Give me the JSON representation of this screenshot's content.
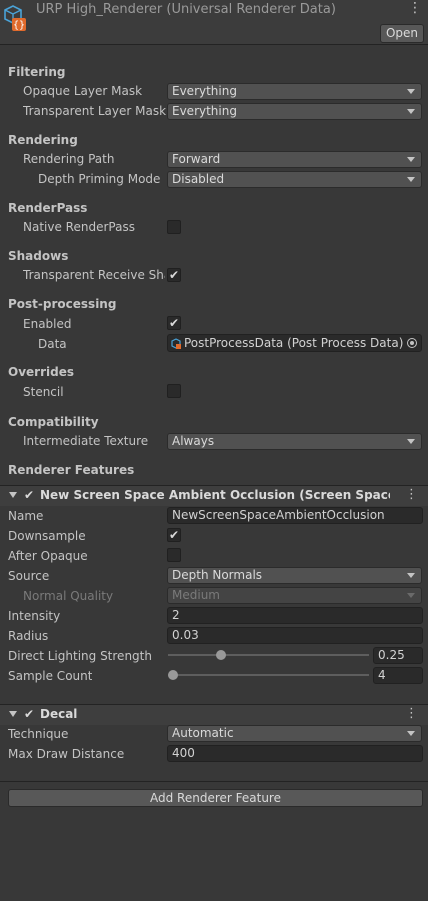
{
  "header": {
    "title": "URP High_Renderer (Universal Renderer Data)",
    "open_label": "Open",
    "menu_icon": "kebab-menu-icon",
    "asset_icon": "renderer-data-asset-icon"
  },
  "filtering": {
    "section": "Filtering",
    "opaque_label": "Opaque Layer Mask",
    "opaque_value": "Everything",
    "transparent_label": "Transparent Layer Mask",
    "transparent_value": "Everything"
  },
  "rendering": {
    "section": "Rendering",
    "path_label": "Rendering Path",
    "path_value": "Forward",
    "depth_label": "Depth Priming Mode",
    "depth_value": "Disabled"
  },
  "renderpass": {
    "section": "RenderPass",
    "native_label": "Native RenderPass",
    "native_checked": false
  },
  "shadows": {
    "section": "Shadows",
    "transparent_label": "Transparent Receive Sha",
    "transparent_checked": true
  },
  "postprocessing": {
    "section": "Post-processing",
    "enabled_label": "Enabled",
    "enabled_checked": true,
    "data_label": "Data",
    "data_value": "PostProcessData (Post Process Data)"
  },
  "overrides": {
    "section": "Overrides",
    "stencil_label": "Stencil",
    "stencil_checked": false
  },
  "compatibility": {
    "section": "Compatibility",
    "intermediate_label": "Intermediate Texture",
    "intermediate_value": "Always"
  },
  "renderer_features": {
    "section": "Renderer Features",
    "ssao": {
      "title": "New Screen Space Ambient Occlusion (Screen Space Amb",
      "enabled": true,
      "name_label": "Name",
      "name_value": "NewScreenSpaceAmbientOcclusion",
      "downsample_label": "Downsample",
      "downsample_checked": true,
      "after_opaque_label": "After Opaque",
      "after_opaque_checked": false,
      "source_label": "Source",
      "source_value": "Depth Normals",
      "normal_quality_label": "Normal Quality",
      "normal_quality_value": "Medium",
      "intensity_label": "Intensity",
      "intensity_value": "2",
      "radius_label": "Radius",
      "radius_value": "0.03",
      "direct_label": "Direct Lighting Strength",
      "direct_value": "0.25",
      "direct_fraction": 0.25,
      "sample_label": "Sample Count",
      "sample_value": "4",
      "sample_fraction": 0.0
    },
    "decal": {
      "title": "Decal",
      "enabled": true,
      "technique_label": "Technique",
      "technique_value": "Automatic",
      "max_draw_label": "Max Draw Distance",
      "max_draw_value": "400"
    },
    "add_label": "Add Renderer Feature"
  }
}
